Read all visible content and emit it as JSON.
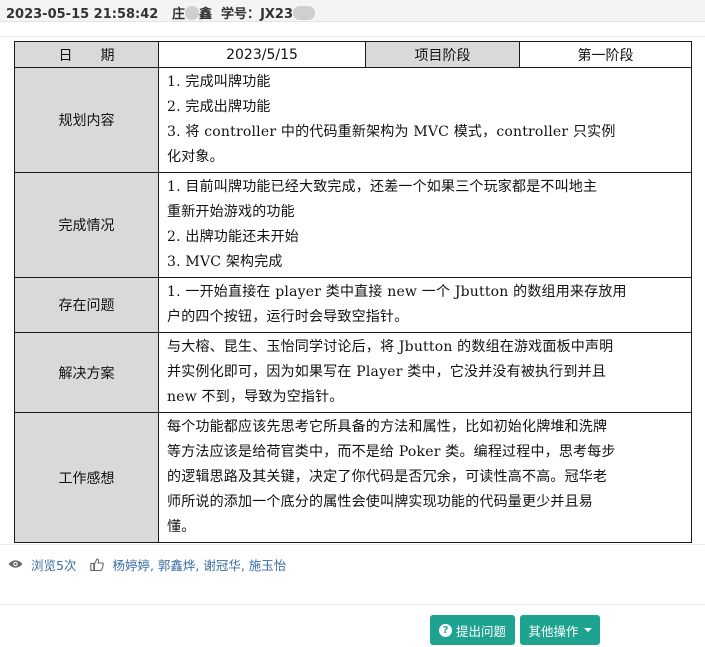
{
  "header": {
    "datetime": "2023-05-15 21:58:42",
    "name_prefix": "庄",
    "name_suffix": "鑫",
    "student_id_label": "学号：",
    "student_id_value": "JX23"
  },
  "journal": {
    "date_label": "日　　期",
    "date_value": "2023/5/15",
    "stage_label": "项目阶段",
    "stage_value": "第一阶段",
    "rows": [
      {
        "label": "规划内容",
        "lines": [
          "1. 完成叫牌功能",
          "2. 完成出牌功能",
          "3. 将 controller 中的代码重新架构为 MVC 模式，controller 只实例",
          "化对象。"
        ]
      },
      {
        "label": "完成情况",
        "lines": [
          "1. 目前叫牌功能已经大致完成，还差一个如果三个玩家都是不叫地主",
          "重新开始游戏的功能",
          "2. 出牌功能还未开始",
          "3. MVC 架构完成"
        ]
      },
      {
        "label": "存在问题",
        "lines": [
          "1. 一开始直接在 player 类中直接 new 一个 Jbutton 的数组用来存放用",
          "户的四个按钮，运行时会导致空指针。"
        ]
      },
      {
        "label": "解决方案",
        "lines": [
          "与大榕、昆生、玉怡同学讨论后，将 Jbutton 的数组在游戏面板中声明",
          "并实例化即可，因为如果写在 Player 类中，它没并没有被执行到并且",
          "new 不到，导致为空指针。"
        ]
      },
      {
        "label": "工作感想",
        "lines": [
          "每个功能都应该先思考它所具备的方法和属性，比如初始化牌堆和洗牌",
          "等方法应该是给荷官类中，而不是给 Poker 类。编程过程中，思考每步",
          "的逻辑思路及其关键，决定了你代码是否冗余，可读性高不高。冠华老",
          "师所说的添加一个底分的属性会使叫牌实现功能的代码量更少并且易",
          "懂。"
        ]
      }
    ]
  },
  "meta": {
    "views": "浏览5次",
    "likers": "杨婷婷, 郭鑫烨, 谢冠华, 施玉怡",
    "icons": [
      "eye-icon",
      "thumbs-up-icon"
    ]
  },
  "actions": {
    "ask_label": "提出问题",
    "more_label": "其他操作"
  },
  "colors": {
    "accent": "#1fa391",
    "link": "#3a6ea5",
    "label_bg": "#d9d9d9"
  }
}
